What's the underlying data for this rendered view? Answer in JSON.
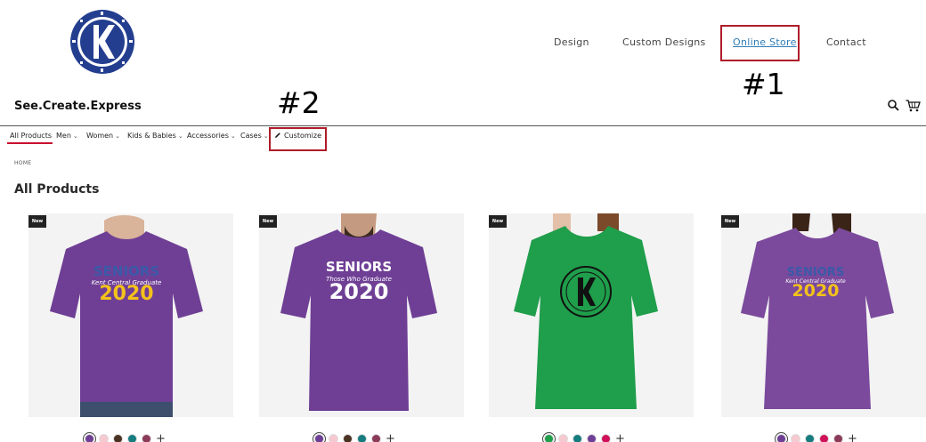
{
  "header": {
    "brand": "See.Create.Express",
    "nav": [
      "Design",
      "Custom Designs",
      "Online Store",
      "Contact"
    ],
    "annotations": [
      "#1",
      "#2"
    ]
  },
  "catbar": {
    "items": [
      {
        "label": "All Products",
        "dropdown": false,
        "active": true
      },
      {
        "label": "Men",
        "dropdown": true
      },
      {
        "label": "Women",
        "dropdown": true
      },
      {
        "label": "Kids & Babies",
        "dropdown": true
      },
      {
        "label": "Accessories",
        "dropdown": true
      },
      {
        "label": "Cases",
        "dropdown": true
      },
      {
        "label": "Customize",
        "dropdown": false,
        "icon": "pencil-icon"
      }
    ]
  },
  "breadcrumb": "HOME",
  "page_title": "All Products",
  "products": [
    {
      "badge": "New",
      "shirt_color": "#6f3f95",
      "print": {
        "line1": "SENIORS",
        "line2": "Kent Central Graduate",
        "line3": "2020",
        "color1": "#3a5aa8",
        "color3": "#f3c21b"
      },
      "swatches": [
        "#6f3f95",
        "#f6c9d0",
        "#4a3222",
        "#157c7f",
        "#8c3a5a"
      ]
    },
    {
      "badge": "New",
      "shirt_color": "#6f3f95",
      "print": {
        "line1": "SENIORS",
        "line2": "Those Who Graduate",
        "line3": "2020",
        "color1": "#ffffff",
        "color3": "#ffffff"
      },
      "swatches": [
        "#6f3f95",
        "#f6c9d0",
        "#4a3222",
        "#157c7f",
        "#8c3a5a"
      ]
    },
    {
      "badge": "New",
      "shirt_color": "#1f9e4b",
      "print": {
        "line1": "",
        "line2": "",
        "line3": "",
        "color1": "#000000",
        "color3": "#000000"
      },
      "swatches": [
        "#1f9e4b",
        "#f6c9d0",
        "#157c7f",
        "#6f3f95",
        "#d0115a"
      ]
    },
    {
      "badge": "New",
      "shirt_color": "#7b4a9c",
      "print": {
        "line1": "SENIORS",
        "line2": "Kent Central Graduate",
        "line3": "2020",
        "color1": "#3a5aa8",
        "color3": "#f3c21b"
      },
      "swatches": [
        "#6f3f95",
        "#f6c9d0",
        "#157c7f",
        "#d0115a",
        "#8c3a5a"
      ]
    }
  ],
  "icons": {
    "search": "search-icon",
    "cart": "cart-icon",
    "logo": "logo-emblem"
  },
  "colors": {
    "accent": "#c8102e",
    "annotation": "#b01c2a",
    "link": "#2f7db8"
  }
}
